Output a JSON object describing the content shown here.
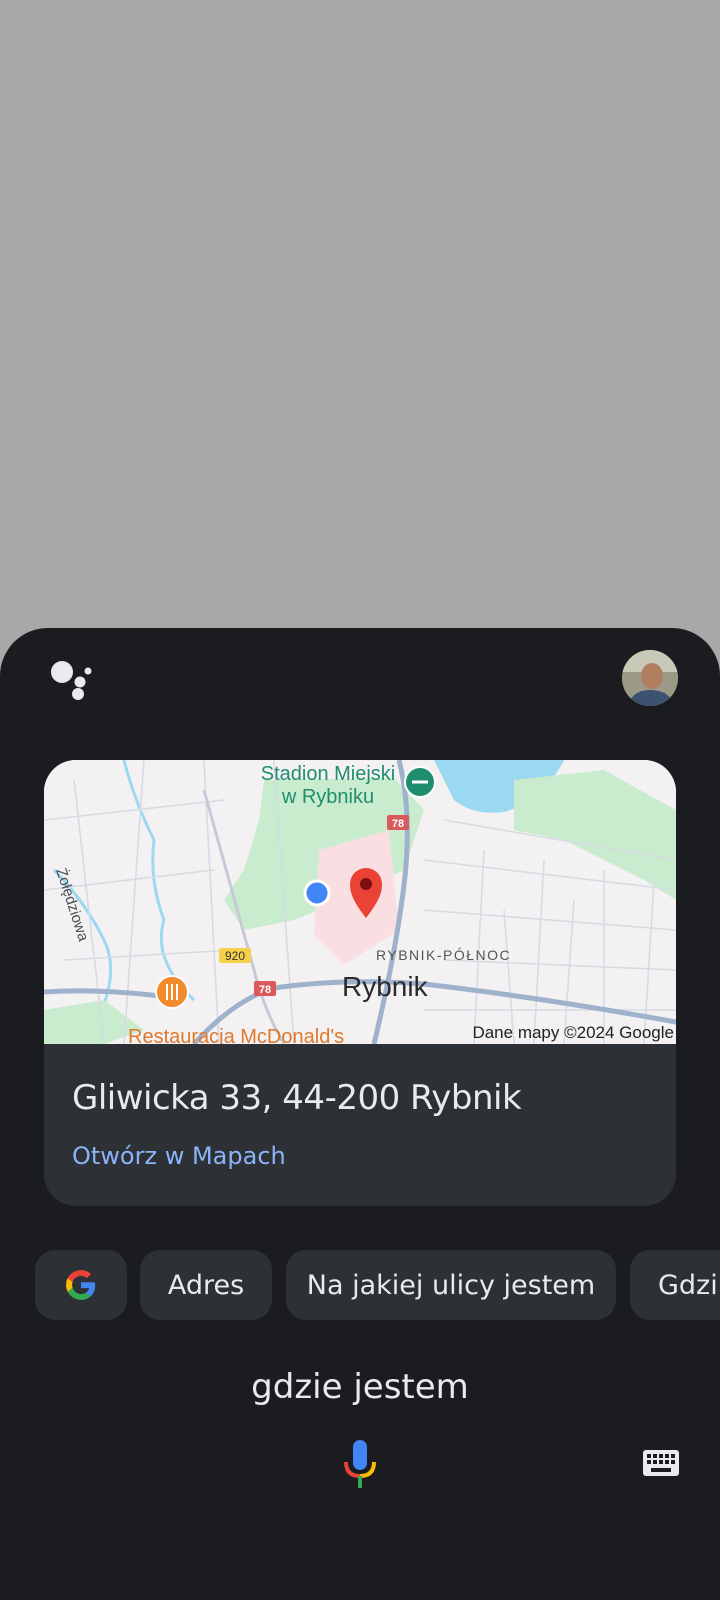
{
  "assistant": {
    "logo_icon": "google-assistant-dots-icon",
    "avatar_icon": "user-avatar"
  },
  "map": {
    "labels": {
      "stadium_line1": "Stadion Miejski",
      "stadium_line2": "w Rybniku",
      "street": "Żołędziowa",
      "district": "RYBNIK-PÓŁNOC",
      "city": "Rybnik",
      "restaurant": "Restauracja McDonald's",
      "road_920": "920",
      "road_78a": "78",
      "road_78b": "78",
      "attribution": "Dane mapy ©2024 Google"
    },
    "colors": {
      "pin": "#ea4335",
      "location_dot": "#4285f4",
      "water": "#9bd9f0",
      "park": "#c9ecce"
    }
  },
  "result": {
    "address": "Gliwicka 33, 44-200 Rybnik",
    "open_link": "Otwórz w Mapach"
  },
  "chips": {
    "google_icon": "google-g-icon",
    "items": [
      "Adres",
      "Na jakiej ulicy jestem",
      "Gdzi"
    ]
  },
  "query": {
    "text": "gdzie jestem"
  },
  "controls": {
    "mic_icon": "microphone-icon",
    "keyboard_icon": "keyboard-icon"
  }
}
